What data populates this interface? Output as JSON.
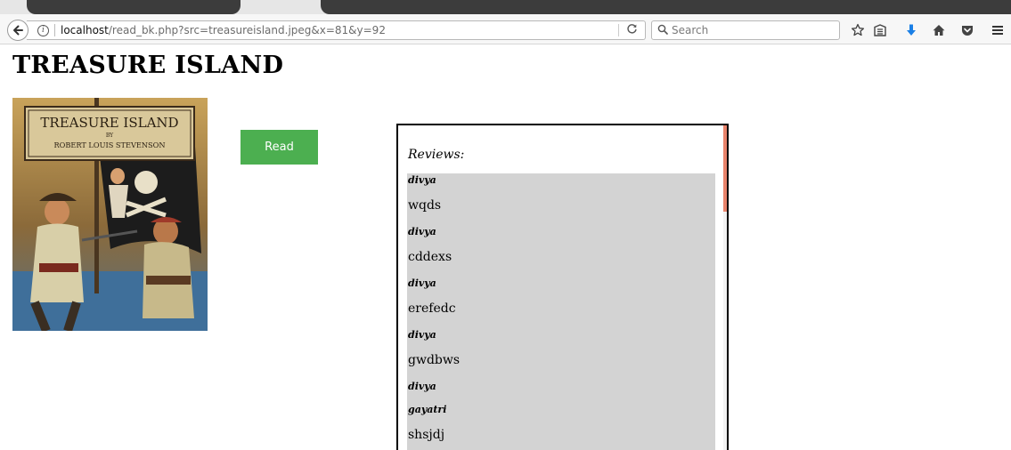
{
  "browser": {
    "url_host": "localhost",
    "url_path": "/read_bk.php?src=treasureisland.jpeg&x=81&y=92",
    "search_placeholder": "Search"
  },
  "page": {
    "title": "TREASURE ISLAND",
    "read_label": "Read"
  },
  "cover": {
    "title": "TREASURE ISLAND",
    "by": "BY",
    "author": "ROBERT LOUIS STEVENSON"
  },
  "reviews": {
    "heading": "Reviews:",
    "items": [
      {
        "author": "divya",
        "text": "wqds"
      },
      {
        "author": "divya",
        "text": "cddexs"
      },
      {
        "author": "divya",
        "text": "erefedc"
      },
      {
        "author": "divya",
        "text": "gwdbws"
      },
      {
        "author": "divya",
        "text": ""
      },
      {
        "author": "gayatri",
        "text": "shsjdj"
      }
    ]
  },
  "colors": {
    "read_button": "#4caf50",
    "review_bg": "#d3d3d3",
    "scroll_thumb": "#e8836b",
    "download_icon": "#1a7fe6"
  }
}
